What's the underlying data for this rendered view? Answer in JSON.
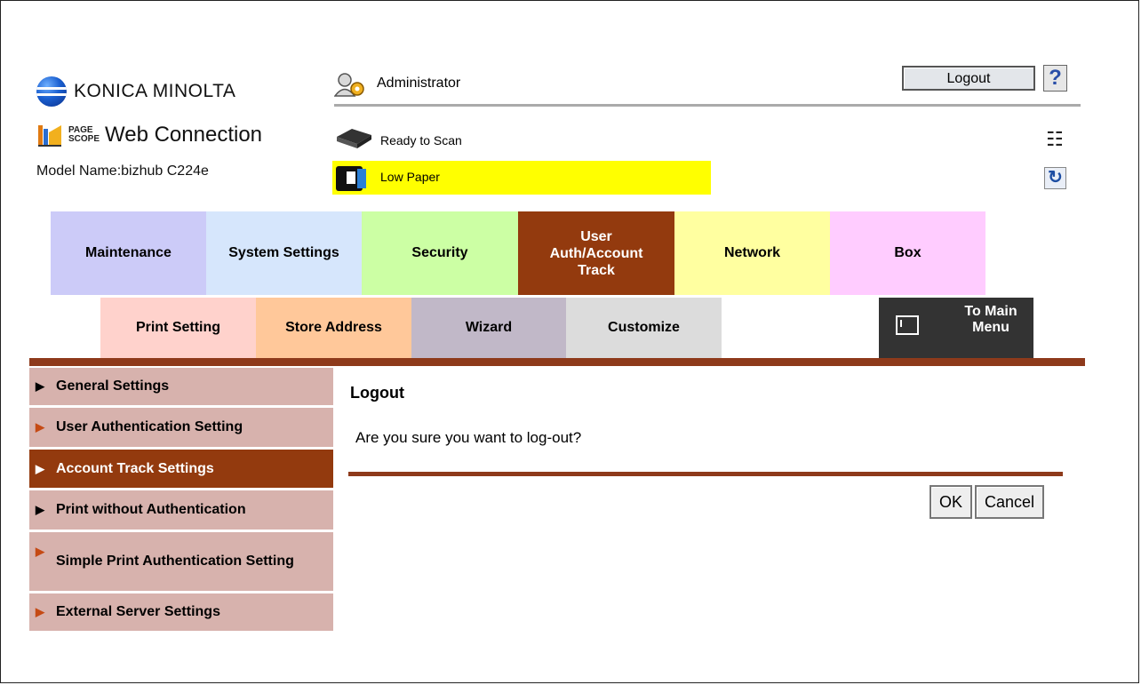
{
  "brand": {
    "name": "KONICA MINOLTA",
    "ps_small_top": "PAGE",
    "ps_small_bottom": "SCOPE",
    "ps_title": "Web Connection"
  },
  "model": "Model Name:bizhub C224e",
  "header": {
    "user": "Administrator",
    "logout_label": "Logout",
    "help_label": "?"
  },
  "status": {
    "scan": "Ready to Scan",
    "paper": "Low Paper",
    "paper_highlight": "#ffff00"
  },
  "tabs": [
    {
      "label": "Maintenance",
      "color": "#cccbf8"
    },
    {
      "label": "System Settings",
      "color": "#d6e6fc"
    },
    {
      "label": "Security",
      "color": "#ccffa4"
    },
    {
      "label": "User Auth/Account Track",
      "color": "#933a0e"
    },
    {
      "label": "Network",
      "color": "#ffffa0"
    },
    {
      "label": "Box",
      "color": "#ffccff"
    }
  ],
  "subtabs": [
    {
      "label": "Print Setting",
      "color": "#ffd2cc"
    },
    {
      "label": "Store Address",
      "color": "#ffc89a"
    },
    {
      "label": "Wizard",
      "color": "#c1b8c8"
    },
    {
      "label": "Customize",
      "color": "#dcdcdc"
    }
  ],
  "to_main_menu": "To Main Menu",
  "sidebar": [
    {
      "label": "General Settings"
    },
    {
      "label": "User Authentication Setting"
    },
    {
      "label": "Account Track Settings"
    },
    {
      "label": "Print without Authentication"
    },
    {
      "label": "Simple Print Authentication Setting"
    },
    {
      "label": "External Server Settings"
    }
  ],
  "content": {
    "title": "Logout",
    "message": "Are you sure you want to log-out?",
    "ok": "OK",
    "cancel": "Cancel"
  },
  "accent": "#8e3a1b"
}
